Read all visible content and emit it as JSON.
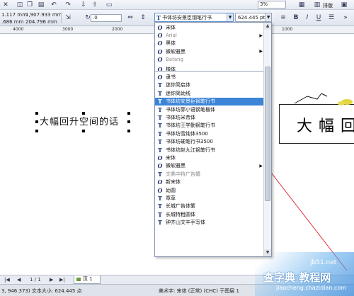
{
  "toolbar": {
    "x_label": "1.117 mm",
    "y_label": "1,907.933 mm",
    "w_label": ".686 mm",
    "h_label": "204.796 mm",
    "rotation_value": ".0",
    "zoom_value": "3%",
    "layout_label": "排版",
    "font_name": "书体坊安景臣钢笔行书",
    "font_size": "624.445 pt"
  },
  "ruler": {
    "labels": [
      "4000",
      "3000",
      "2000",
      "1000",
      "0",
      "1000"
    ]
  },
  "font_list": {
    "items": [
      {
        "icon": "O",
        "name": "宋体",
        "gray": false,
        "submenu": false,
        "selected": false
      },
      {
        "icon": "O",
        "name": "Arial",
        "gray": true,
        "submenu": true,
        "selected": false
      },
      {
        "icon": "O",
        "name": "黑体",
        "gray": false,
        "submenu": false,
        "selected": false
      },
      {
        "icon": "O",
        "name": "微软雅黑",
        "gray": false,
        "submenu": true,
        "selected": false
      },
      {
        "icon": "O",
        "name": "Batang",
        "gray": true,
        "submenu": false,
        "selected": false
      },
      {
        "icon": "O",
        "name": "楷体",
        "gray": false,
        "submenu": false,
        "selected": false
      },
      {
        "icon": "O",
        "name": "隶书",
        "gray": false,
        "submenu": false,
        "selected": false
      },
      {
        "icon": "T",
        "name": "迷你简启体",
        "gray": false,
        "submenu": false,
        "selected": false
      },
      {
        "icon": "T",
        "name": "迷你简幼线",
        "gray": false,
        "submenu": false,
        "selected": false
      },
      {
        "icon": "T",
        "name": "书体坊安景臣钢笔行书",
        "gray": false,
        "submenu": false,
        "selected": true
      },
      {
        "icon": "T",
        "name": "书体坊郭小语钢笔楷体",
        "gray": false,
        "submenu": false,
        "selected": false
      },
      {
        "icon": "T",
        "name": "书体坊米芾体",
        "gray": false,
        "submenu": false,
        "selected": false
      },
      {
        "icon": "T",
        "name": "书体坊王学勤钢笔行书",
        "gray": false,
        "submenu": false,
        "selected": false
      },
      {
        "icon": "T",
        "name": "书体坊雪纯体3500",
        "gray": false,
        "submenu": false,
        "selected": false
      },
      {
        "icon": "T",
        "name": "书体坊硬笔行书3500",
        "gray": false,
        "submenu": false,
        "selected": false
      },
      {
        "icon": "T",
        "name": "书体坊赵九江钢笔行书",
        "gray": false,
        "submenu": false,
        "selected": false
      },
      {
        "icon": "O",
        "name": "宋体",
        "gray": false,
        "submenu": false,
        "selected": false
      },
      {
        "icon": "O",
        "name": "微软雅黑",
        "gray": false,
        "submenu": true,
        "selected": false
      },
      {
        "icon": "T",
        "name": "文鼎中特广告體",
        "gray": true,
        "submenu": false,
        "selected": false
      },
      {
        "icon": "O",
        "name": "新宋体",
        "gray": false,
        "submenu": false,
        "selected": false
      },
      {
        "icon": "O",
        "name": "幼圆",
        "gray": false,
        "submenu": false,
        "selected": false
      },
      {
        "icon": "T",
        "name": "章草",
        "gray": false,
        "submenu": false,
        "selected": false
      },
      {
        "icon": "T",
        "name": "长城广告体繁",
        "gray": false,
        "submenu": false,
        "selected": false
      },
      {
        "icon": "T",
        "name": "长城特粗圆体",
        "gray": false,
        "submenu": false,
        "selected": false
      },
      {
        "icon": "T",
        "name": "钟齐山文丰手写体",
        "gray": false,
        "submenu": false,
        "selected": false
      }
    ]
  },
  "canvas": {
    "selected_text": "大幅回升空间的话",
    "preview_text": "大幅回"
  },
  "pagebar": {
    "page_counter": "1 / 1",
    "page_tab": "页 1"
  },
  "status": {
    "coords_size": "3, 946.373)  文本大小: 624.445 点",
    "font_info": "美术字: 宋体 (正常) (CHC) 于图层 1"
  },
  "watermark": {
    "site": "jb51.net",
    "brand": "查字典 教程网",
    "url": "jiaocheng.chazidian.com"
  },
  "colors": {
    "highlight": "#3b84d8",
    "arrow": "#e0303a"
  }
}
